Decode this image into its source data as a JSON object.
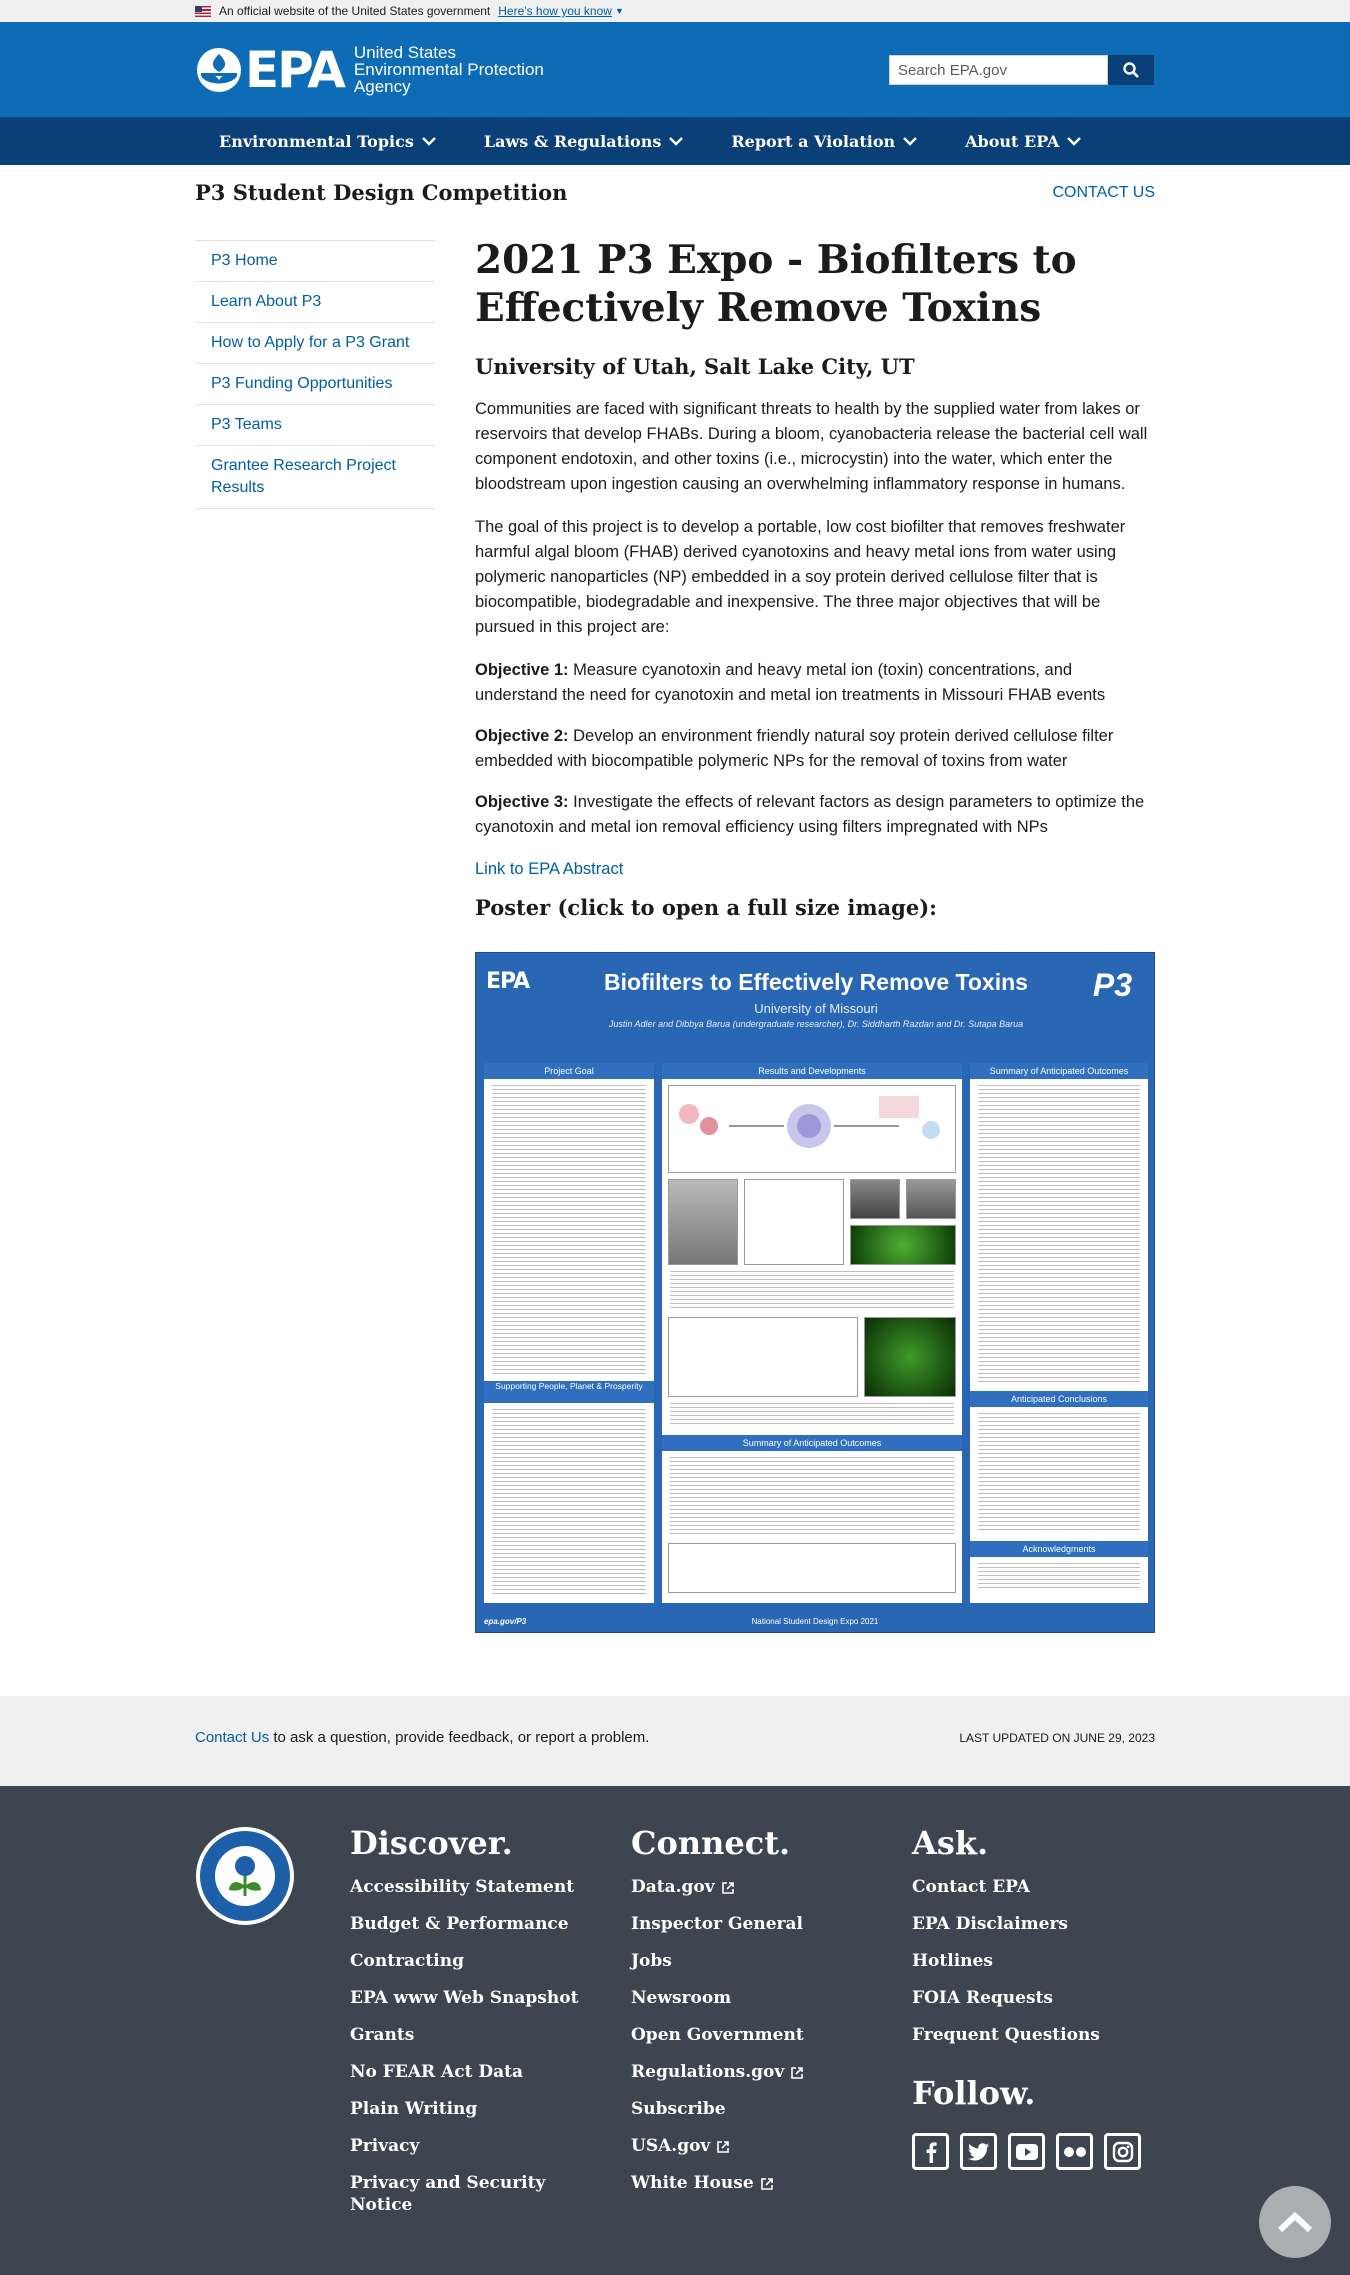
{
  "gov_banner": {
    "text": "An official website of the United States government",
    "link": "Here's how you know"
  },
  "header": {
    "logo_word": "EPA",
    "logo_line1": "United States",
    "logo_line2": "Environmental Protection",
    "logo_line3": "Agency",
    "search_placeholder": "Search EPA.gov"
  },
  "nav": [
    "Environmental Topics",
    "Laws & Regulations",
    "Report a Violation",
    "About EPA"
  ],
  "site": {
    "title": "P3 Student Design Competition",
    "contact": "CONTACT US"
  },
  "sidebar": [
    "P3 Home",
    "Learn About P3",
    "How to Apply for a P3 Grant",
    "P3 Funding Opportunities",
    "P3 Teams",
    "Grantee Research Project Results"
  ],
  "main": {
    "title": "2021 P3 Expo - Biofilters to Effectively Remove Toxins",
    "subtitle": "University of Utah, Salt Lake City, UT",
    "para1": "Communities are faced with significant threats to health by the supplied water from lakes or reservoirs that develop FHABs. During a bloom, cyanobacteria release the bacterial cell wall component endotoxin, and other toxins (i.e., microcystin) into the water, which enter the bloodstream upon ingestion causing an overwhelming inflammatory response in humans.",
    "para2": "The goal of this project is to develop a portable, low cost biofilter that removes freshwater harmful algal bloom (FHAB) derived cyanotoxins and heavy metal ions from water using polymeric nanoparticles (NP) embedded in a soy protein derived cellulose filter that is biocompatible, biodegradable and inexpensive. The three major objectives that will be pursued in this project are:",
    "objectives": [
      {
        "label": "Objective 1:",
        "text": " Measure cyanotoxin and heavy metal ion (toxin) concentrations, and understand the need for cyanotoxin and metal ion treatments in Missouri FHAB events"
      },
      {
        "label": "Objective 2:",
        "text": " Develop an environment friendly natural soy protein derived cellulose filter embedded with biocompatible polymeric NPs for the removal of toxins from water"
      },
      {
        "label": "Objective 3:",
        "text": " Investigate the effects of relevant factors as design parameters to optimize the cyanotoxin and metal ion removal efficiency using filters impregnated with NPs"
      }
    ],
    "abstract_link": "Link to EPA Abstract",
    "poster_heading": "Poster (click to open a full size image):"
  },
  "poster": {
    "epa": "EPA",
    "title": "Biofilters to Effectively Remove Toxins",
    "university": "University of Missouri",
    "authors": "Justin Adler and Dibbya Barua (undergraduate researcher), Dr. Siddharth Razdan and Dr. Sutapa Barua",
    "logo": "P3",
    "sections": [
      "Project Goal",
      "Results and Developments",
      "Summary of Anticipated Outcomes",
      "Supporting People, Planet & Prosperity",
      "Summary of Anticipated Outcomes",
      "Anticipated Conclusions",
      "Acknowledgments"
    ],
    "footer_left": "epa.gov/P3",
    "footer_center": "National Student Design Expo 2021"
  },
  "feedback": {
    "link": "Contact Us",
    "text": " to ask a question, provide feedback, or report a problem.",
    "updated": "LAST UPDATED ON JUNE 29, 2023"
  },
  "footer": {
    "discover": {
      "heading": "Discover.",
      "links": [
        "Accessibility Statement",
        "Budget & Performance",
        "Contracting",
        "EPA www Web Snapshot",
        "Grants",
        "No FEAR Act Data",
        "Plain Writing",
        "Privacy",
        "Privacy and Security Notice"
      ]
    },
    "connect": {
      "heading": "Connect.",
      "links": [
        "Data.gov",
        "Inspector General",
        "Jobs",
        "Newsroom",
        "Open Government",
        "Regulations.gov",
        "Subscribe",
        "USA.gov",
        "White House"
      ]
    },
    "ask": {
      "heading": "Ask.",
      "links": [
        "Contact EPA",
        "EPA Disclaimers",
        "Hotlines",
        "FOIA Requests",
        "Frequent Questions"
      ]
    },
    "follow": "Follow.",
    "social_icons": [
      "facebook-icon",
      "twitter-icon",
      "youtube-icon",
      "flickr-icon",
      "instagram-icon"
    ],
    "seal_text": "UNITED STATES ENVIRONMENTAL PROTECTION AGENCY"
  },
  "colors": {
    "header": "#0e6cb6",
    "nav": "#0b3f78",
    "footer": "#3d4551",
    "link": "#005ea2"
  }
}
